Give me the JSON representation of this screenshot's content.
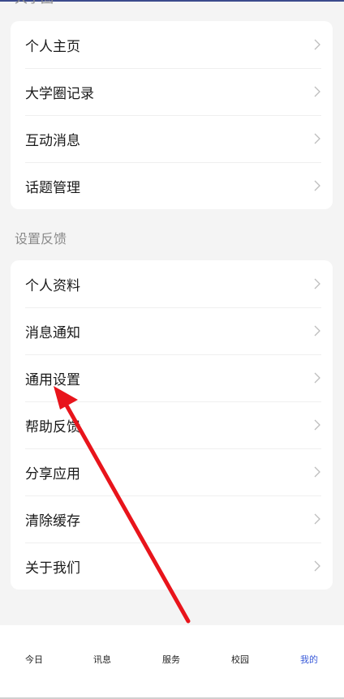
{
  "sections": {
    "campus": {
      "title": "大学圈",
      "items": [
        {
          "label": "个人主页",
          "icon": "chevron-right-icon"
        },
        {
          "label": "大学圈记录",
          "icon": "chevron-right-icon"
        },
        {
          "label": "互动消息",
          "icon": "chevron-right-icon"
        },
        {
          "label": "话题管理",
          "icon": "chevron-right-icon"
        }
      ]
    },
    "settings": {
      "title": "设置反馈",
      "items": [
        {
          "label": "个人资料",
          "icon": "chevron-right-icon"
        },
        {
          "label": "消息通知",
          "icon": "chevron-right-icon"
        },
        {
          "label": "通用设置",
          "icon": "chevron-right-icon"
        },
        {
          "label": "帮助反馈",
          "icon": "chevron-right-icon"
        },
        {
          "label": "分享应用",
          "icon": "chevron-right-icon"
        },
        {
          "label": "清除缓存",
          "icon": "chevron-right-icon"
        },
        {
          "label": "关于我们",
          "icon": "chevron-right-icon"
        }
      ]
    }
  },
  "tabbar": {
    "tabs": [
      {
        "label": "今日",
        "active": false
      },
      {
        "label": "讯息",
        "active": false
      },
      {
        "label": "服务",
        "active": false
      },
      {
        "label": "校园",
        "active": false
      },
      {
        "label": "我的",
        "active": true
      }
    ],
    "active_color": "#3a5bd9"
  },
  "annotation": {
    "color": "#e8141b",
    "target": "通用设置"
  },
  "colors": {
    "background": "#f4f4f4",
    "card": "#ffffff",
    "section_title": "#8a8a8a"
  }
}
